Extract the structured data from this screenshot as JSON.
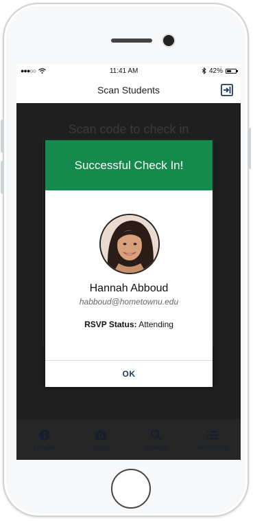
{
  "status_bar": {
    "time": "11:41 AM",
    "battery_percent": "42%",
    "signal_icon": "●●●○○",
    "wifi_icon": "wifi-icon",
    "bluetooth_icon": "bluetooth-icon"
  },
  "nav": {
    "title": "Scan Students",
    "action_icon": "logout-icon"
  },
  "camera": {
    "hint": "Scan code to check in"
  },
  "modal": {
    "title": "Successful Check In!",
    "name": "Hannah Abboud",
    "email": "habboud@hometownu.edu",
    "rsvp_label": "RSVP Status:",
    "rsvp_value": "Attending",
    "ok_label": "OK"
  },
  "tabs": [
    {
      "label": "Details",
      "icon": "info-icon"
    },
    {
      "label": "Scan",
      "icon": "camera-icon"
    },
    {
      "label": "Lookup",
      "icon": "search-icon"
    },
    {
      "label": "Attendees",
      "icon": "list-icon"
    }
  ],
  "colors": {
    "accent_green": "#168a4d",
    "tab_icon": "#2a3a55",
    "ok_text": "#1c3a5a"
  }
}
